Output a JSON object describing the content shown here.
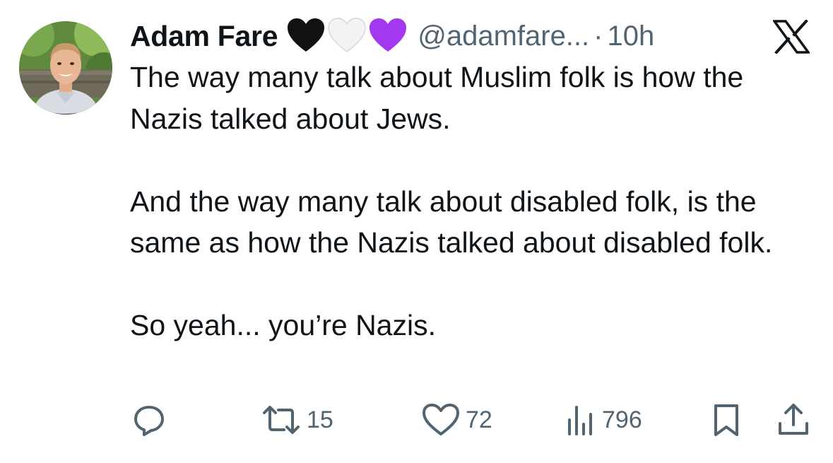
{
  "post": {
    "author": {
      "display_name": "Adam Fare",
      "handle": "@adamfare...",
      "separator": "·",
      "time": "10h",
      "badges": [
        "black-heart",
        "white-heart",
        "purple-heart"
      ]
    },
    "text": {
      "p1": "The way many talk about Muslim folk is how the Nazis talked about Jews.",
      "p2": "And the way many talk about disabled folk, is the same as how the Nazis talked about disabled folk.",
      "p3": "So yeah... you’re Nazis."
    },
    "metrics": {
      "reposts": "15",
      "likes": "72",
      "views": "796"
    }
  },
  "icons": {
    "brand": "x-logo-icon",
    "reply": "reply-icon",
    "repost": "repost-icon",
    "like": "like-icon",
    "views": "views-icon",
    "bookmark": "bookmark-icon",
    "share": "share-icon"
  },
  "colors": {
    "text": "#0f1419",
    "secondary": "#536471",
    "black_heart": "#111111",
    "white_heart": "#f1f1f1",
    "purple_heart": "#a437f0",
    "avatar_ring": "#4a1f5c"
  }
}
